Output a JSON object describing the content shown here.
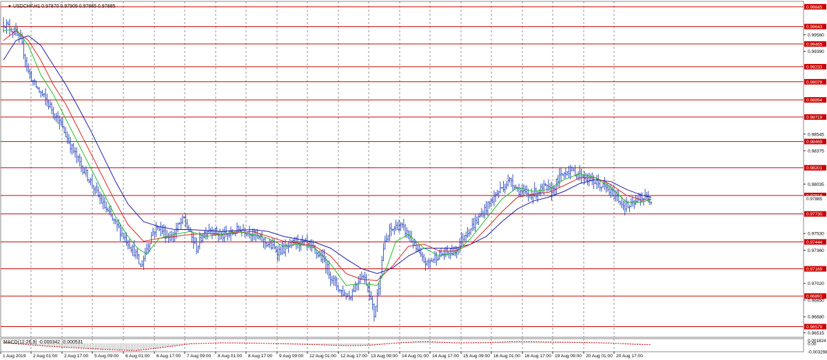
{
  "header": {
    "arrow": "▼",
    "text": "USDCHF,H1  0.97870 0.97909 0.97865 0.97885"
  },
  "macd_header": {
    "text": "MACD(12,26,9) -0.000342 -0.000531"
  },
  "colors": {
    "price_bars": "#2f4fbf",
    "level_lines": "#cc0000",
    "ma_fast": "#22bb22",
    "ma_mid": "#dd2222",
    "ma_slow": "#1a1aaa",
    "macd_signal": "#cc0000",
    "macd_hist": "#b0b0b0",
    "grid": "#777777"
  },
  "chart_data": {
    "type": "candlestick",
    "symbol": "USDCHF",
    "timeframe": "H1",
    "ylim": [
      0.9647,
      0.999
    ],
    "y_ticks": [
      "0.99560",
      "0.99390",
      "0.98545",
      "0.98375",
      "0.98035",
      "0.97530",
      "0.97360",
      "0.97020",
      "0.96850",
      "0.96680",
      "0.96515"
    ],
    "levels": [
      {
        "value": 0.99845,
        "label": "0.99845"
      },
      {
        "value": 0.99643,
        "label": "0.99643"
      },
      {
        "value": 0.99465,
        "label": "0.99465"
      },
      {
        "value": 0.99233,
        "label": "0.99233"
      },
      {
        "value": 0.99079,
        "label": "0.99079"
      },
      {
        "value": 0.98894,
        "label": "0.98894"
      },
      {
        "value": 0.98719,
        "label": "0.98719"
      },
      {
        "value": 0.98469,
        "label": "0.98469"
      },
      {
        "value": 0.98201,
        "label": "0.98201"
      },
      {
        "value": 0.97918,
        "label": "0.97918"
      },
      {
        "value": 0.9773,
        "label": "0.97730"
      },
      {
        "value": 0.97444,
        "label": "0.97444"
      },
      {
        "value": 0.97169,
        "label": "0.97169"
      },
      {
        "value": 0.96891,
        "label": "0.96891"
      },
      {
        "value": 0.96579,
        "label": "0.96579"
      }
    ],
    "current_price": {
      "value": 0.97885,
      "label": "0.97885"
    },
    "x_labels": [
      "1 Aug 2019",
      "2 Aug 01:00",
      "2 Aug 17:00",
      "5 Aug 09:00",
      "6 Aug 01:00",
      "6 Aug 17:00",
      "7 Aug 09:00",
      "8 Aug 01:00",
      "8 Aug 17:00",
      "9 Aug 09:00",
      "12 Aug 01:00",
      "12 Aug 17:00",
      "13 Aug 09:00",
      "14 Aug 01:00",
      "14 Aug 17:00",
      "15 Aug 09:00",
      "16 Aug 01:00",
      "16 Aug 17:00",
      "19 Aug 09:00",
      "20 Aug 01:00",
      "20 Aug 17:00"
    ],
    "price_path": [
      [
        0,
        0.9968
      ],
      [
        4,
        0.9963
      ],
      [
        8,
        0.9958
      ],
      [
        12,
        0.9945
      ],
      [
        16,
        0.9918
      ],
      [
        20,
        0.9905
      ],
      [
        26,
        0.9892
      ],
      [
        32,
        0.9878
      ],
      [
        38,
        0.986
      ],
      [
        44,
        0.984
      ],
      [
        50,
        0.9822
      ],
      [
        56,
        0.9806
      ],
      [
        62,
        0.9788
      ],
      [
        68,
        0.9772
      ],
      [
        74,
        0.9758
      ],
      [
        80,
        0.9744
      ],
      [
        85,
        0.9732
      ],
      [
        88,
        0.9718
      ],
      [
        92,
        0.9738
      ],
      [
        96,
        0.9755
      ],
      [
        100,
        0.976
      ],
      [
        104,
        0.9752
      ],
      [
        108,
        0.9748
      ],
      [
        112,
        0.976
      ],
      [
        116,
        0.9768
      ],
      [
        120,
        0.9752
      ],
      [
        124,
        0.9738
      ],
      [
        128,
        0.9752
      ],
      [
        132,
        0.9758
      ],
      [
        136,
        0.9755
      ],
      [
        140,
        0.975
      ],
      [
        146,
        0.9752
      ],
      [
        152,
        0.9758
      ],
      [
        158,
        0.9755
      ],
      [
        164,
        0.9748
      ],
      [
        170,
        0.9742
      ],
      [
        176,
        0.9735
      ],
      [
        182,
        0.9738
      ],
      [
        188,
        0.9745
      ],
      [
        194,
        0.9742
      ],
      [
        200,
        0.9735
      ],
      [
        206,
        0.9725
      ],
      [
        210,
        0.971
      ],
      [
        216,
        0.9695
      ],
      [
        222,
        0.9688
      ],
      [
        226,
        0.97
      ],
      [
        230,
        0.9712
      ],
      [
        234,
        0.97
      ],
      [
        238,
        0.967
      ],
      [
        241,
        0.97
      ],
      [
        244,
        0.9738
      ],
      [
        248,
        0.9755
      ],
      [
        254,
        0.9762
      ],
      [
        260,
        0.9752
      ],
      [
        264,
        0.974
      ],
      [
        268,
        0.9728
      ],
      [
        272,
        0.9722
      ],
      [
        278,
        0.973
      ],
      [
        284,
        0.9733
      ],
      [
        290,
        0.9735
      ],
      [
        296,
        0.9752
      ],
      [
        302,
        0.9762
      ],
      [
        308,
        0.9775
      ],
      [
        314,
        0.9788
      ],
      [
        320,
        0.98
      ],
      [
        326,
        0.9808
      ],
      [
        330,
        0.9798
      ],
      [
        336,
        0.9792
      ],
      [
        342,
        0.9795
      ],
      [
        348,
        0.98
      ],
      [
        352,
        0.9795
      ],
      [
        356,
        0.9808
      ],
      [
        362,
        0.9818
      ],
      [
        368,
        0.9815
      ],
      [
        374,
        0.981
      ],
      [
        380,
        0.9805
      ],
      [
        386,
        0.98
      ],
      [
        390,
        0.9795
      ],
      [
        394,
        0.979
      ],
      [
        398,
        0.9782
      ],
      [
        402,
        0.978
      ],
      [
        406,
        0.9785
      ],
      [
        410,
        0.979
      ],
      [
        414,
        0.9788
      ],
      [
        416,
        0.9788
      ]
    ],
    "ma_fast_path": [
      [
        0,
        0.996
      ],
      [
        8,
        0.9962
      ],
      [
        16,
        0.9945
      ],
      [
        24,
        0.9915
      ],
      [
        32,
        0.9895
      ],
      [
        40,
        0.987
      ],
      [
        48,
        0.9845
      ],
      [
        56,
        0.982
      ],
      [
        64,
        0.9795
      ],
      [
        72,
        0.977
      ],
      [
        80,
        0.975
      ],
      [
        86,
        0.9738
      ],
      [
        92,
        0.9732
      ],
      [
        100,
        0.9748
      ],
      [
        110,
        0.9752
      ],
      [
        120,
        0.9755
      ],
      [
        130,
        0.975
      ],
      [
        140,
        0.9752
      ],
      [
        150,
        0.9755
      ],
      [
        160,
        0.9752
      ],
      [
        170,
        0.9748
      ],
      [
        180,
        0.974
      ],
      [
        190,
        0.9742
      ],
      [
        200,
        0.9738
      ],
      [
        210,
        0.9722
      ],
      [
        220,
        0.97
      ],
      [
        230,
        0.9702
      ],
      [
        240,
        0.97
      ],
      [
        246,
        0.9718
      ],
      [
        252,
        0.9745
      ],
      [
        260,
        0.9752
      ],
      [
        270,
        0.9738
      ],
      [
        280,
        0.973
      ],
      [
        290,
        0.9733
      ],
      [
        300,
        0.9748
      ],
      [
        310,
        0.9768
      ],
      [
        320,
        0.9788
      ],
      [
        330,
        0.98
      ],
      [
        340,
        0.9796
      ],
      [
        350,
        0.9798
      ],
      [
        360,
        0.9808
      ],
      [
        370,
        0.9814
      ],
      [
        380,
        0.981
      ],
      [
        390,
        0.98
      ],
      [
        400,
        0.9785
      ],
      [
        410,
        0.9785
      ],
      [
        416,
        0.9788
      ]
    ],
    "ma_mid_path": [
      [
        0,
        0.995
      ],
      [
        8,
        0.996
      ],
      [
        16,
        0.995
      ],
      [
        24,
        0.993
      ],
      [
        32,
        0.9905
      ],
      [
        40,
        0.9885
      ],
      [
        48,
        0.986
      ],
      [
        56,
        0.9835
      ],
      [
        64,
        0.981
      ],
      [
        72,
        0.9785
      ],
      [
        80,
        0.9762
      ],
      [
        90,
        0.9745
      ],
      [
        100,
        0.9748
      ],
      [
        110,
        0.975
      ],
      [
        120,
        0.9752
      ],
      [
        130,
        0.9753
      ],
      [
        140,
        0.9752
      ],
      [
        150,
        0.9754
      ],
      [
        160,
        0.9755
      ],
      [
        170,
        0.975
      ],
      [
        180,
        0.9745
      ],
      [
        190,
        0.9743
      ],
      [
        200,
        0.974
      ],
      [
        210,
        0.973
      ],
      [
        220,
        0.9712
      ],
      [
        230,
        0.9706
      ],
      [
        240,
        0.9705
      ],
      [
        250,
        0.972
      ],
      [
        260,
        0.974
      ],
      [
        270,
        0.9742
      ],
      [
        280,
        0.9735
      ],
      [
        290,
        0.9735
      ],
      [
        300,
        0.9742
      ],
      [
        310,
        0.9758
      ],
      [
        320,
        0.9775
      ],
      [
        330,
        0.979
      ],
      [
        340,
        0.9793
      ],
      [
        350,
        0.9795
      ],
      [
        360,
        0.9802
      ],
      [
        370,
        0.981
      ],
      [
        380,
        0.981
      ],
      [
        390,
        0.9803
      ],
      [
        400,
        0.9792
      ],
      [
        410,
        0.9787
      ],
      [
        416,
        0.9788
      ]
    ],
    "ma_slow_path": [
      [
        0,
        0.993
      ],
      [
        8,
        0.995
      ],
      [
        16,
        0.9955
      ],
      [
        24,
        0.9945
      ],
      [
        32,
        0.9925
      ],
      [
        40,
        0.9905
      ],
      [
        48,
        0.9882
      ],
      [
        56,
        0.9858
      ],
      [
        64,
        0.9832
      ],
      [
        72,
        0.9806
      ],
      [
        80,
        0.9783
      ],
      [
        90,
        0.9765
      ],
      [
        100,
        0.976
      ],
      [
        110,
        0.9757
      ],
      [
        120,
        0.9757
      ],
      [
        130,
        0.9756
      ],
      [
        140,
        0.9755
      ],
      [
        150,
        0.9756
      ],
      [
        160,
        0.9757
      ],
      [
        170,
        0.9755
      ],
      [
        180,
        0.975
      ],
      [
        190,
        0.9747
      ],
      [
        200,
        0.9744
      ],
      [
        210,
        0.9738
      ],
      [
        220,
        0.9727
      ],
      [
        230,
        0.9717
      ],
      [
        240,
        0.9712
      ],
      [
        250,
        0.9718
      ],
      [
        260,
        0.973
      ],
      [
        270,
        0.9738
      ],
      [
        280,
        0.9738
      ],
      [
        290,
        0.9738
      ],
      [
        300,
        0.9742
      ],
      [
        310,
        0.975
      ],
      [
        320,
        0.9765
      ],
      [
        330,
        0.9778
      ],
      [
        340,
        0.9786
      ],
      [
        350,
        0.979
      ],
      [
        360,
        0.9796
      ],
      [
        370,
        0.9804
      ],
      [
        380,
        0.9808
      ],
      [
        390,
        0.9806
      ],
      [
        400,
        0.9798
      ],
      [
        410,
        0.9792
      ],
      [
        416,
        0.979
      ]
    ],
    "macd": {
      "ylim": [
        -0.003298,
        0.001824
      ],
      "y_ticks": [
        "0.001824",
        "0.00",
        "-0.003298"
      ],
      "signal_path": [
        [
          0,
          0.0002
        ],
        [
          15,
          -0.0005
        ],
        [
          30,
          -0.0012
        ],
        [
          50,
          -0.0019
        ],
        [
          70,
          -0.0025
        ],
        [
          85,
          -0.0028
        ],
        [
          100,
          -0.0018
        ],
        [
          120,
          -0.0002
        ],
        [
          140,
          0.0002
        ],
        [
          160,
          0.0001
        ],
        [
          180,
          -0.0002
        ],
        [
          200,
          -0.0005
        ],
        [
          220,
          -0.0009
        ],
        [
          235,
          -0.0008
        ],
        [
          255,
          0.0003
        ],
        [
          270,
          0.0007
        ],
        [
          290,
          0.0002
        ],
        [
          310,
          0.0003
        ],
        [
          330,
          0.0007
        ],
        [
          350,
          0.0005
        ],
        [
          370,
          0.0004
        ],
        [
          390,
          0.0001
        ],
        [
          405,
          -0.0004
        ],
        [
          416,
          -0.0005
        ]
      ]
    }
  }
}
